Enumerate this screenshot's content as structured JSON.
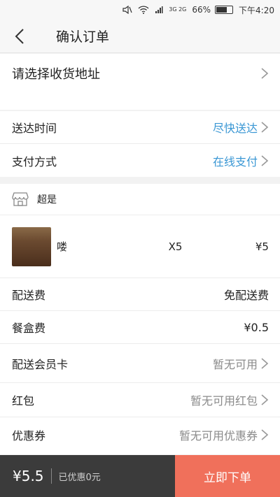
{
  "status_bar": {
    "battery": "66%",
    "time": "下午4:20",
    "network": "3G 2G",
    "battery_level": 0.66
  },
  "nav": {
    "title": "确认订单"
  },
  "address": {
    "label": "请选择收货地址"
  },
  "delivery": {
    "time_label": "送达时间",
    "time_value": "尽快送达",
    "pay_label": "支付方式",
    "pay_value": "在线支付"
  },
  "shop": {
    "name": "超是"
  },
  "item": {
    "name": "喽",
    "qty": "X5",
    "price": "¥5"
  },
  "fees": {
    "delivery_label": "配送费",
    "delivery_value": "免配送费",
    "box_label": "餐盒费",
    "box_value": "¥0.5",
    "member_label": "配送会员卡",
    "member_value": "暂无可用"
  },
  "promos": {
    "redpack_label": "红包",
    "redpack_value": "暂无可用红包",
    "coupon_label": "优惠券",
    "coupon_value": "暂无可用优惠券"
  },
  "bottom": {
    "total": "¥5.5",
    "discount": "已优惠0元",
    "submit": "立即下单"
  }
}
